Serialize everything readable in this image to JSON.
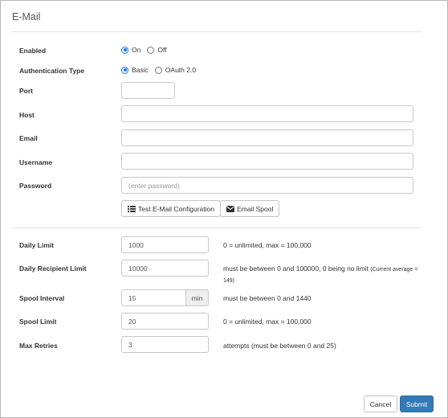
{
  "panel": {
    "title": "E-Mail"
  },
  "enabled": {
    "label": "Enabled",
    "options": [
      "On",
      "Off"
    ],
    "selected": "On"
  },
  "auth": {
    "label": "Authentication Type",
    "options": [
      "Basic",
      "OAuth 2.0"
    ],
    "selected": "Basic"
  },
  "port": {
    "label": "Port",
    "value": ""
  },
  "host": {
    "label": "Host",
    "value": ""
  },
  "email": {
    "label": "Email",
    "value": ""
  },
  "username": {
    "label": "Username",
    "value": ""
  },
  "password": {
    "label": "Password",
    "placeholder": "(enter password)"
  },
  "actions": {
    "test_label": "Test E-Mail Configuration",
    "spool_label": "Email Spool"
  },
  "daily_limit": {
    "label": "Daily Limit",
    "value": "1000",
    "help": "0 = unlimited, max = 100,000"
  },
  "daily_recipient_limit": {
    "label": "Daily Recipient Limit",
    "value": "10000",
    "help": "must be between 0 and 100000, 0 being no limit",
    "help_note": "(Current average = 149)"
  },
  "spool_interval": {
    "label": "Spool Interval",
    "value": "15",
    "unit": "min",
    "help": "must be between 0 and 1440"
  },
  "spool_limit": {
    "label": "Spool Limit",
    "value": "20",
    "help": "0 = unlimited, max = 100,000"
  },
  "max_retries": {
    "label": "Max Retries",
    "value": "3",
    "help": "attempts (must be between 0 and 25)"
  },
  "footer": {
    "cancel_label": "Cancel",
    "submit_label": "Submit"
  },
  "colors": {
    "primary": "#337ab7",
    "radio_accent": "#1a73e8"
  },
  "icons": {
    "test": "list-icon",
    "spool": "envelope-icon"
  }
}
